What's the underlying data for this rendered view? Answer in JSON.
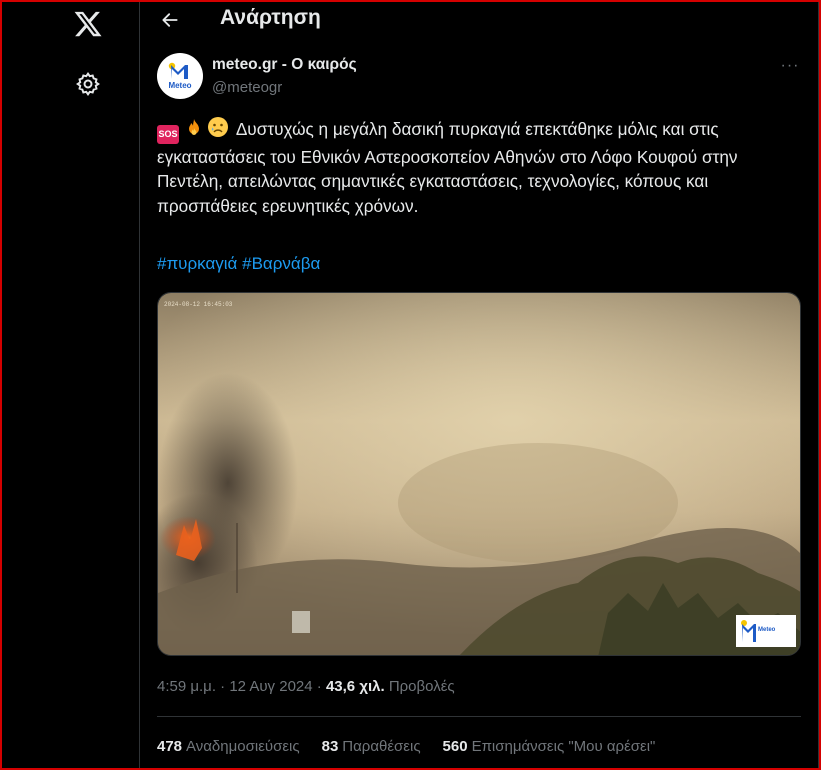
{
  "nav": {
    "logo_icon": "x-logo-icon",
    "settings_icon": "gear-icon"
  },
  "header": {
    "back_icon": "arrow-left-icon",
    "title": "Ανάρτηση"
  },
  "post": {
    "author": {
      "display_name": "meteo.gr - Ο καιρός",
      "handle": "@meteogr",
      "avatar_label": "Meteo"
    },
    "more_label": "···",
    "emojis": [
      "sos",
      "fire",
      "crying-face"
    ],
    "sos_label": "SOS",
    "text": "Δυστυχώς η μεγάλη δασική πυρκαγιά επεκτάθηκε μόλις και στις εγκαταστάσεις του Εθνικόν Αστεροσκοπείον Αθηνών στο Λόφο Κουφού στην Πεντέλη, απειλώντας σημαντικές εγκαταστάσεις, τεχνολογίες, κόπους και προσπάθειες ερευνητικές χρόνων.",
    "hashtags": [
      "#πυρκαγιά",
      "#Βαρνάβα"
    ],
    "media": {
      "overlay_timestamp": "2024-08-12  16:45:03",
      "watermark_label": "Meteo",
      "colors": {
        "smoke": "#c9b48a",
        "haze": "#a89572",
        "fire": "#d04a1c"
      }
    },
    "time": "4:59 μ.μ.",
    "date": "12 Αυγ 2024",
    "separator": "·",
    "views_count": "43,6 χιλ.",
    "views_label": "Προβολές",
    "stats": {
      "reposts_count": "478",
      "reposts_label": "Αναδημοσιεύσεις",
      "quotes_count": "83",
      "quotes_label": "Παραθέσεις",
      "likes_count": "560",
      "likes_label": "Επισημάνσεις \"Μου αρέσει\""
    }
  },
  "colors": {
    "background": "#000000",
    "text": "#e7e9ea",
    "muted": "#71767b",
    "accent": "#1d9bf0",
    "border": "#2f3336",
    "frame": "#d40000"
  }
}
